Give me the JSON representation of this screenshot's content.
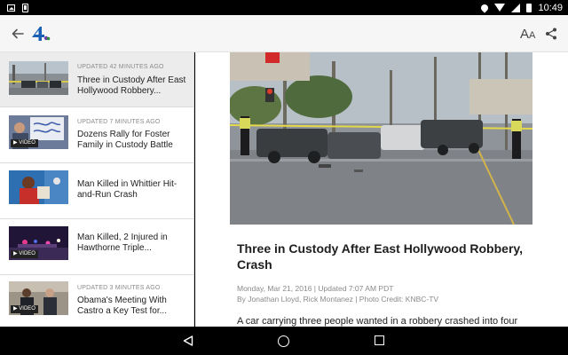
{
  "status_bar": {
    "left_icons": [
      "image-notification-icon",
      "phone-notification-icon"
    ],
    "right_icons": [
      "location-icon",
      "wifi-icon",
      "cell-signal-icon",
      "battery-icon"
    ],
    "time": "10:49"
  },
  "app_bar": {
    "back_icon": "arrow-left-icon",
    "logo_icon": "nbc4-logo-icon",
    "text_size_label_big": "A",
    "text_size_label_small": "A",
    "share_icon": "share-icon"
  },
  "stories": [
    {
      "meta": "UPDATED 42 MINUTES AGO",
      "title": "Three in Custody After East Hollywood Robbery...",
      "video": false,
      "selected": true
    },
    {
      "meta": "UPDATED 7 MINUTES AGO",
      "title": "Dozens Rally for Foster Family in Custody Battle",
      "video": true,
      "video_label": "VIDEO",
      "selected": false
    },
    {
      "meta": "",
      "title": "Man Killed in Whittier Hit-and-Run Crash",
      "video": false,
      "selected": false
    },
    {
      "meta": "",
      "title": "Man Killed, 2 Injured in Hawthorne Triple...",
      "video": true,
      "video_label": "VIDEO",
      "selected": false
    },
    {
      "meta": "UPDATED 3 MINUTES AGO",
      "title": "Obama's Meeting With Castro a Key Test for...",
      "video": true,
      "video_label": "VIDEO",
      "selected": false
    }
  ],
  "article": {
    "headline": "Three in Custody After East Hollywood Robbery, Crash",
    "dateline": "Monday, Mar 21, 2016 | Updated 7:07 AM PDT",
    "byline": "By Jonathan Lloyd, Rick Montanez | Photo Credit: KNBC-TV",
    "lede": "A car carrying three people wanted in a robbery crashed into four"
  },
  "nav_bar": {
    "icons": [
      "nav-back-icon",
      "nav-home-icon",
      "nav-recents-icon"
    ]
  },
  "colors": {
    "app_bar_bg": "#f6f6f6",
    "selected_item_bg": "#ececec",
    "meta_text": "#8a8a8a",
    "title_text": "#222222"
  }
}
